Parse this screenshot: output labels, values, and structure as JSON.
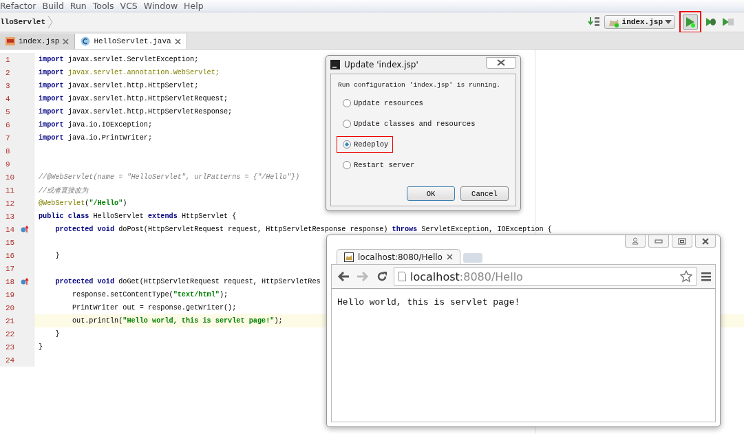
{
  "menu": [
    "Refactor",
    "Build",
    "Run",
    "Tools",
    "VCS",
    "Window",
    "Help"
  ],
  "breadcrumb": "lloServlet",
  "run_config": {
    "label": "index.jsp"
  },
  "run_button": {
    "highlighted": true
  },
  "tabs": [
    {
      "label": "index.jsp",
      "kind": "jsp",
      "selected": false
    },
    {
      "label": "HelloServlet.java",
      "kind": "class",
      "selected": true
    }
  ],
  "lines": [
    {
      "number": "1",
      "current": false,
      "override": false,
      "tokens": [
        {
          "kind": "kw",
          "text": "import"
        },
        {
          "kind": "t",
          "text": " javax.servlet.ServletException;"
        }
      ]
    },
    {
      "number": "2",
      "current": false,
      "override": false,
      "tokens": [
        {
          "kind": "kw",
          "text": "import"
        },
        {
          "kind": "dim",
          "text": " javax.servlet.annotation.WebServlet;"
        }
      ]
    },
    {
      "number": "3",
      "current": false,
      "override": false,
      "tokens": [
        {
          "kind": "kw",
          "text": "import"
        },
        {
          "kind": "t",
          "text": " javax.servlet.http.HttpServlet;"
        }
      ]
    },
    {
      "number": "4",
      "current": false,
      "override": false,
      "tokens": [
        {
          "kind": "kw",
          "text": "import"
        },
        {
          "kind": "t",
          "text": " javax.servlet.http.HttpServletRequest;"
        }
      ]
    },
    {
      "number": "5",
      "current": false,
      "override": false,
      "tokens": [
        {
          "kind": "kw",
          "text": "import"
        },
        {
          "kind": "t",
          "text": " javax.servlet.http.HttpServletResponse;"
        }
      ]
    },
    {
      "number": "6",
      "current": false,
      "override": false,
      "tokens": [
        {
          "kind": "kw",
          "text": "import"
        },
        {
          "kind": "t",
          "text": " java.io.IOException;"
        }
      ]
    },
    {
      "number": "7",
      "current": false,
      "override": false,
      "tokens": [
        {
          "kind": "kw",
          "text": "import"
        },
        {
          "kind": "t",
          "text": " java.io.PrintWriter;"
        }
      ]
    },
    {
      "number": "8",
      "current": false,
      "override": false
    },
    {
      "number": "9",
      "current": false,
      "override": false
    },
    {
      "number": "10",
      "current": false,
      "override": false,
      "tokens": [
        {
          "kind": "cm",
          "text": "//@WebServlet(name = \"HelloServlet\", urlPatterns = {\"/Hello\"})"
        }
      ]
    },
    {
      "number": "11",
      "current": false,
      "override": false,
      "tokens": [
        {
          "kind": "cm",
          "text": "//或者直接改为"
        }
      ]
    },
    {
      "number": "12",
      "current": false,
      "override": false,
      "tokens": [
        {
          "kind": "an",
          "text": "@WebServlet"
        },
        {
          "kind": "t",
          "text": "("
        },
        {
          "kind": "str",
          "text": "\"/Hello\""
        },
        {
          "kind": "t",
          "text": ")"
        }
      ]
    },
    {
      "number": "13",
      "current": false,
      "override": false,
      "tokens": [
        {
          "kind": "kw",
          "text": "public class"
        },
        {
          "kind": "t",
          "text": " HelloServlet "
        },
        {
          "kind": "kw",
          "text": "extends"
        },
        {
          "kind": "t",
          "text": " HttpServlet {"
        }
      ]
    },
    {
      "number": "14",
      "current": false,
      "override": true,
      "tokens": [
        {
          "kind": "kw",
          "text": "    protected void"
        },
        {
          "kind": "t",
          "text": " doPost(HttpServletRequest request, HttpServletResponse response) "
        },
        {
          "kind": "kw",
          "text": "throws"
        },
        {
          "kind": "t",
          "text": " ServletException, IOException {"
        }
      ]
    },
    {
      "number": "15",
      "current": false,
      "override": false
    },
    {
      "number": "16",
      "current": false,
      "override": false,
      "tokens": [
        {
          "kind": "t",
          "text": "    }"
        }
      ]
    },
    {
      "number": "17",
      "current": false,
      "override": false
    },
    {
      "number": "18",
      "current": false,
      "override": true,
      "tokens": [
        {
          "kind": "kw",
          "text": "    protected void"
        },
        {
          "kind": "t",
          "text": " doGet(HttpServletRequest request, HttpServletRes"
        }
      ]
    },
    {
      "number": "19",
      "current": false,
      "override": false,
      "tokens": [
        {
          "kind": "t",
          "text": "        response.setContentType("
        },
        {
          "kind": "str",
          "text": "\"text/html\""
        },
        {
          "kind": "t",
          "text": ");"
        }
      ]
    },
    {
      "number": "20",
      "current": false,
      "override": false,
      "tokens": [
        {
          "kind": "t",
          "text": "        PrintWriter out = response.getWriter();"
        }
      ]
    },
    {
      "number": "21",
      "current": true,
      "override": false,
      "tokens": [
        {
          "kind": "t",
          "text": "        out.println("
        },
        {
          "kind": "str",
          "text": "\"Hello world, this is servlet page!\""
        },
        {
          "kind": "t",
          "text": ");"
        }
      ]
    },
    {
      "number": "22",
      "current": false,
      "override": false,
      "tokens": [
        {
          "kind": "t",
          "text": "    }"
        }
      ]
    },
    {
      "number": "23",
      "current": false,
      "override": false,
      "tokens": [
        {
          "kind": "t",
          "text": "}"
        }
      ]
    },
    {
      "number": "24",
      "current": false,
      "override": false
    }
  ],
  "dialog": {
    "title": "Update 'index.jsp'",
    "message": "Run configuration 'index.jsp' is running.",
    "options": [
      {
        "label": "Update resources",
        "selected": false,
        "highlighted": false
      },
      {
        "label": "Update classes and resources",
        "selected": false,
        "highlighted": false
      },
      {
        "label": "Redeploy",
        "selected": true,
        "highlighted": true
      },
      {
        "label": "Restart server",
        "selected": false,
        "highlighted": false
      }
    ],
    "buttons": [
      {
        "label": "OK",
        "default": true
      },
      {
        "label": "Cancel",
        "default": false
      }
    ]
  },
  "browser": {
    "tab_title": "localhost:8080/Hello",
    "nav": [
      {
        "kind": "back",
        "disabled": false
      },
      {
        "kind": "forward",
        "disabled": true
      },
      {
        "kind": "reload",
        "disabled": false
      }
    ],
    "url_host": "localhost",
    "url_rest": ":8080/Hello",
    "page_text": "Hello world, this is servlet page!"
  }
}
